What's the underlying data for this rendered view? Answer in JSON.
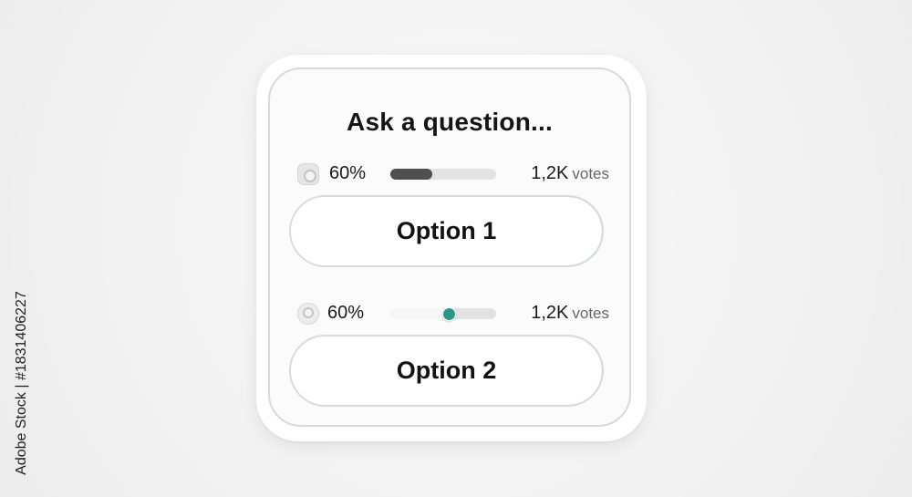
{
  "poll": {
    "title": "Ask a question...",
    "options": [
      {
        "label": "Option 1",
        "percent_text": "60%",
        "percent": 0.4,
        "votes_count": "1,2K",
        "votes_word": "votes"
      },
      {
        "label": "Option 2",
        "percent_text": "60%",
        "percent": 0.55,
        "votes_count": "1,2K",
        "votes_word": "votes"
      }
    ]
  },
  "watermark": {
    "side_text": "Adobe Stock | #1831406227"
  },
  "colors": {
    "accent_option1": "#1f7590",
    "accent_option2": "#2a8f87",
    "bar_fill": "#4f4f4f",
    "slider_knob": "#2b9688"
  }
}
